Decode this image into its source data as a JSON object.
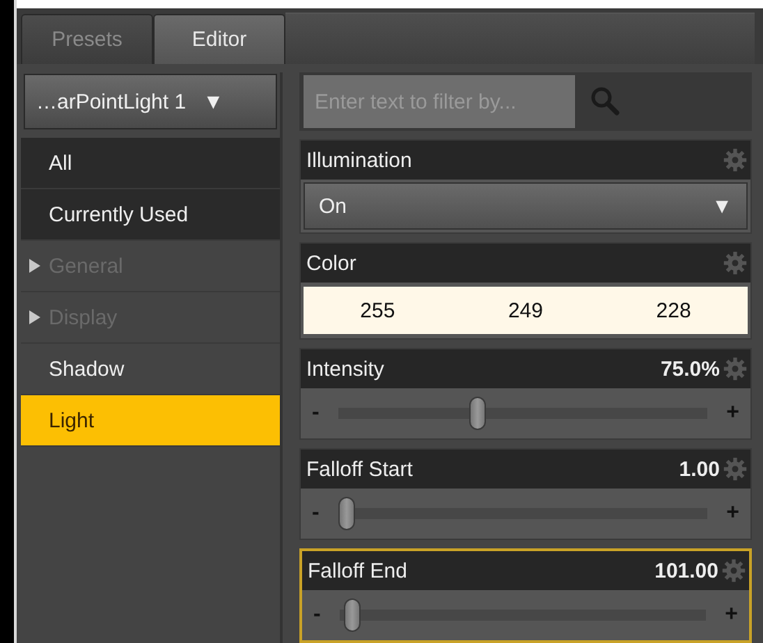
{
  "tabs": [
    {
      "label": "Presets",
      "selected": false
    },
    {
      "label": "Editor",
      "selected": true
    }
  ],
  "node_select": {
    "value": "…arPointLight 1",
    "arrow": "▼"
  },
  "sidebar": {
    "items": [
      {
        "label": "All",
        "kind": "filter",
        "selected": false,
        "disabled": false
      },
      {
        "label": "Currently Used",
        "kind": "filter",
        "selected": false,
        "disabled": false
      },
      {
        "label": "General",
        "kind": "group",
        "selected": false,
        "disabled": true
      },
      {
        "label": "Display",
        "kind": "group",
        "selected": false,
        "disabled": true
      },
      {
        "label": "Shadow",
        "kind": "item",
        "selected": false,
        "disabled": false
      },
      {
        "label": "Light",
        "kind": "item",
        "selected": true,
        "disabled": false
      }
    ]
  },
  "filter": {
    "placeholder": "Enter text to filter by..."
  },
  "properties": [
    {
      "name": "Illumination",
      "kind": "dropdown",
      "value": "On",
      "arrow": "▼",
      "highlighted": false
    },
    {
      "name": "Color",
      "kind": "color",
      "channels": [
        "255",
        "249",
        "228"
      ],
      "highlighted": false
    },
    {
      "name": "Intensity",
      "kind": "slider",
      "reading": "75.0%",
      "level": 0.37,
      "minus": "-",
      "plus": "+",
      "highlighted": false
    },
    {
      "name": "Falloff Start",
      "kind": "slider",
      "reading": "1.00",
      "level": 0.0,
      "minus": "-",
      "plus": "+",
      "highlighted": false
    },
    {
      "name": "Falloff End",
      "kind": "slider",
      "reading": "101.00",
      "level": 0.01,
      "minus": "-",
      "plus": "+",
      "highlighted": true
    }
  ]
}
